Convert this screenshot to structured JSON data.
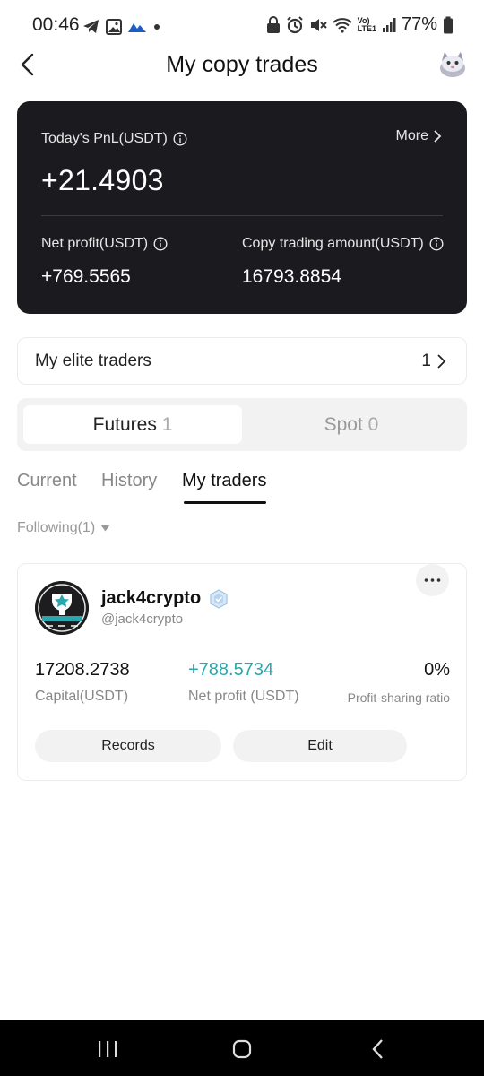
{
  "status_bar": {
    "time": "00:46",
    "left_icons": [
      "telegram-icon",
      "gallery-icon",
      "cloud-icon",
      "dot-icon"
    ],
    "right_icons": [
      "lock-icon",
      "alarm-icon",
      "mute-icon",
      "wifi-icon",
      "volte-icon",
      "signal-icon"
    ],
    "volte_text": "Vo)",
    "lte_text": "LTE1",
    "battery": "77%"
  },
  "header": {
    "title": "My copy trades"
  },
  "summary": {
    "pnl_label": "Today's PnL(USDT)",
    "pnl_value": "+21.4903",
    "more_label": "More",
    "net_profit_label": "Net profit(USDT)",
    "net_profit_value": "+769.5565",
    "copy_amount_label": "Copy trading amount(USDT)",
    "copy_amount_value": "16793.8854"
  },
  "elite_traders": {
    "label": "My elite traders",
    "count": "1"
  },
  "segment": {
    "futures_label": "Futures",
    "futures_count": "1",
    "spot_label": "Spot",
    "spot_count": "0"
  },
  "tabs": {
    "current": "Current",
    "history": "History",
    "my_traders": "My traders",
    "active": "My traders"
  },
  "filter": {
    "following": "Following(1)"
  },
  "trader": {
    "name": "jack4crypto",
    "handle": "@jack4crypto",
    "capital_value": "17208.2738",
    "capital_label": "Capital(USDT)",
    "net_profit_value": "+788.5734",
    "net_profit_label": "Net profit (USDT)",
    "ratio_value": "0%",
    "ratio_label": "Profit-sharing ratio",
    "records_label": "Records",
    "edit_label": "Edit",
    "more_label": "···"
  },
  "colors": {
    "card_dark": "#1b1b1f",
    "accent_teal": "#2aa7ad",
    "nav_bar": "#000000"
  }
}
